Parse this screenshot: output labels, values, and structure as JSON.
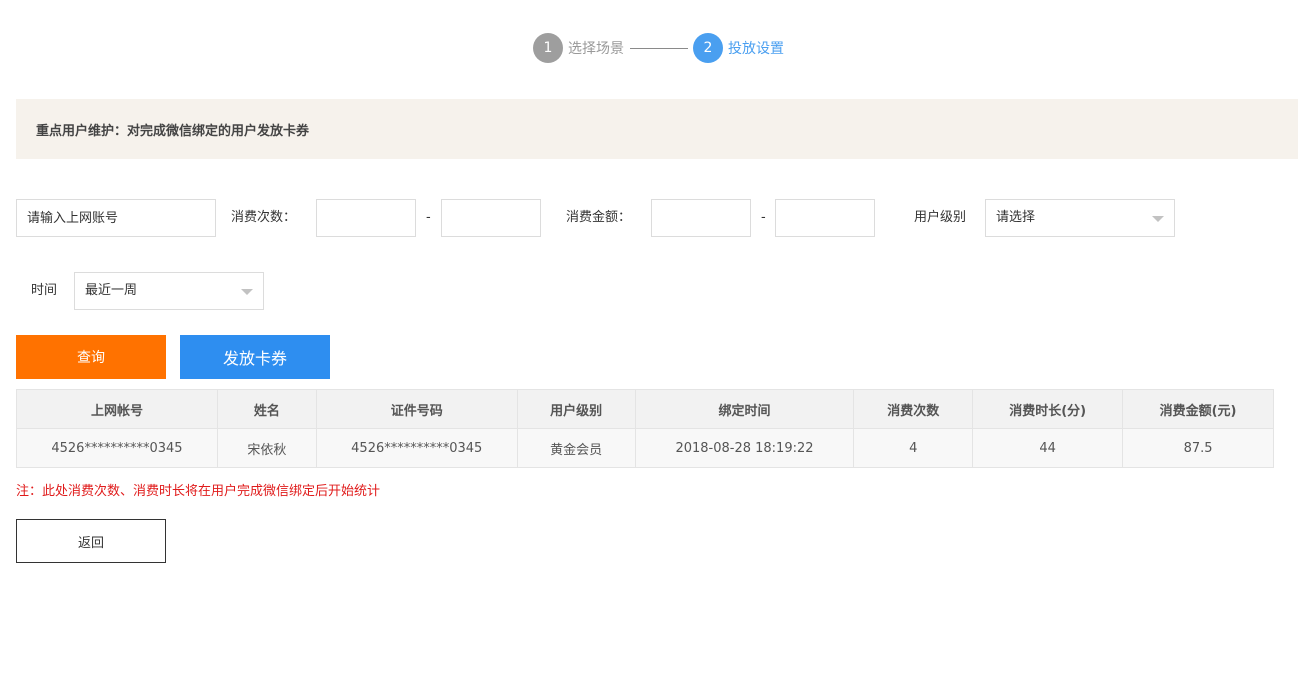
{
  "steps": [
    {
      "number": "1",
      "label": "选择场景",
      "state": "done"
    },
    {
      "number": "2",
      "label": "投放设置",
      "state": "active"
    }
  ],
  "notice": "重点用户维护：对完成微信绑定的用户发放卡券",
  "filters": {
    "account_placeholder": "请输入上网账号",
    "count_label": "消费次数：",
    "dash": "-",
    "amount_label": "消费金额：",
    "level_label": "用户级别",
    "level_select": "请选择",
    "time_label": "时间",
    "time_select": "最近一周"
  },
  "buttons": {
    "query": "查询",
    "issue": "发放卡券",
    "back": "返回"
  },
  "table": {
    "headers": [
      "上网帐号",
      "姓名",
      "证件号码",
      "用户级别",
      "绑定时间",
      "消费次数",
      "消费时长(分)",
      "消费金额(元)"
    ],
    "rows": [
      [
        "4526**********0345",
        "宋依秋",
        "4526**********0345",
        "黄金会员",
        "2018-08-28 18:19:22",
        "4",
        "44",
        "87.5"
      ]
    ]
  },
  "note": "注：此处消费次数、消费时长将在用户完成微信绑定后开始统计",
  "colors": {
    "accent_blue": "#4a9ff0",
    "query_orange": "#ff7200",
    "issue_blue": "#2e8ef0",
    "note_red": "#e01b1b",
    "notice_bg": "#f6f2ec"
  }
}
